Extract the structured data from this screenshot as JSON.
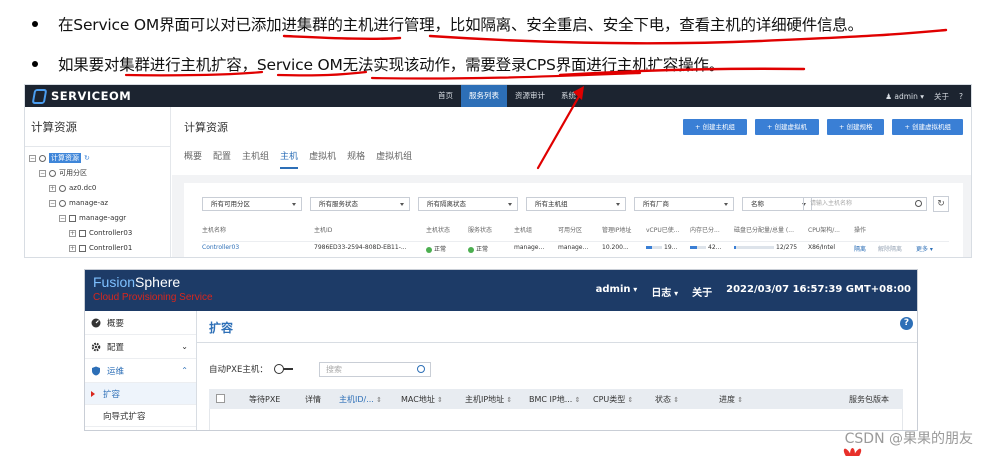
{
  "bullets": [
    "在Service OM界面可以对已添加进集群的主机进行管理，比如隔离、安全重启、安全下电，查看主机的详细硬件信息。",
    "如果要对集群进行主机扩容，Service OM无法实现该动作，需要登录CPS界面进行主机扩容操作。"
  ],
  "service_om": {
    "logo": "SERVICEOM",
    "nav": [
      "首页",
      "服务列表",
      "资源审计",
      "系统"
    ],
    "nav_active": "服务列表",
    "user": "admin",
    "about": "关于",
    "help": "?",
    "sidebar_title": "计算资源",
    "tree": {
      "root": "计算资源",
      "zone": "可用分区",
      "dc": "az0.dc0",
      "az": "manage-az",
      "aggr": "manage-aggr",
      "hosts": [
        "Controller03",
        "Controller01"
      ]
    },
    "page_title": "计算资源",
    "actions": [
      "+ 创建主机组",
      "+ 创建虚拟机",
      "+ 创建规格",
      "+ 创建虚拟机组"
    ],
    "tabs": [
      "概要",
      "配置",
      "主机组",
      "主机",
      "虚拟机",
      "规格",
      "虚拟机组"
    ],
    "tab_active": "主机",
    "filters": [
      "所有可用分区",
      "所有服务状态",
      "所有隔离状态",
      "所有主机组",
      "所有厂商",
      "名称"
    ],
    "search_placeholder": "请输入主机名称",
    "columns": [
      "主机名称",
      "主机ID",
      "主机状态",
      "服务状态",
      "主机组",
      "可用分区",
      "管理IP地址",
      "vCPU已使...",
      "内存已分...",
      "磁盘已分配量/总量 (...",
      "CPU架构/...",
      "操作"
    ],
    "row": {
      "name": "Controller03",
      "id": "7986ED33-2594-808D-EB11-...",
      "host_status": "正常",
      "service_status": "正常",
      "group": "manage...",
      "zone": "manage...",
      "ip": "10.200...",
      "vcpu": "19...",
      "vcpu_fill": 0.4,
      "mem": "42...",
      "mem_fill": 0.45,
      "disk": "12/275",
      "disk_fill": 0.05,
      "arch": "X86/Intel",
      "ops": [
        "隔离",
        "解除隔离",
        "更多"
      ]
    }
  },
  "fusionsphere": {
    "brand_a": "Fusion",
    "brand_b": "Sphere",
    "subtitle": "Cloud Provisioning Service",
    "user": "admin",
    "log": "日志",
    "about": "关于",
    "datetime": "2022/03/07 16:57:39 GMT+08:00",
    "sidebar": [
      "概要",
      "配置",
      "运维"
    ],
    "sub_items": [
      "扩容",
      "向导式扩容"
    ],
    "title": "扩容",
    "pxe_label": "自动PXE主机：",
    "search_placeholder": "搜索",
    "columns": [
      "等待PXE",
      "详情",
      "主机ID/...",
      "MAC地址",
      "主机IP地址",
      "BMC IP地...",
      "CPU类型",
      "状态",
      "进度",
      "服务包版本"
    ]
  },
  "watermark": "CSDN @果果的朋友",
  "colors": {
    "annotation": "#e00000",
    "primary": "#3a7fd5",
    "topbar_dark": "#1c2430",
    "fusion_top": "#1d3b67"
  }
}
